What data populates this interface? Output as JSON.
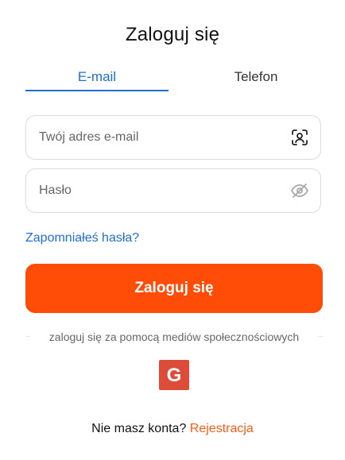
{
  "page": {
    "title": "Zaloguj się"
  },
  "tabs": [
    {
      "label": "E-mail",
      "active": true
    },
    {
      "label": "Telefon",
      "active": false
    }
  ],
  "form": {
    "email": {
      "placeholder": "Twój adres e-mail",
      "value": "",
      "icon": "face-scan-icon"
    },
    "password": {
      "placeholder": "Hasło",
      "value": "",
      "icon": "eye-off-icon"
    },
    "forgot_label": "Zapomniałeś hasła?",
    "submit_label": "Zaloguj się"
  },
  "social": {
    "label": "zaloguj się za pomocą mediów społecznościowych",
    "providers": [
      {
        "name": "Google",
        "glyph": "G",
        "icon": "google-icon",
        "color": "#dd4b39"
      }
    ]
  },
  "footer": {
    "prompt": "Nie masz konta?",
    "register_label": "Rejestracja"
  },
  "colors": {
    "accent": "#1f6fd1",
    "primary_button": "#ff4d08",
    "register_link": "#ff5a14"
  }
}
